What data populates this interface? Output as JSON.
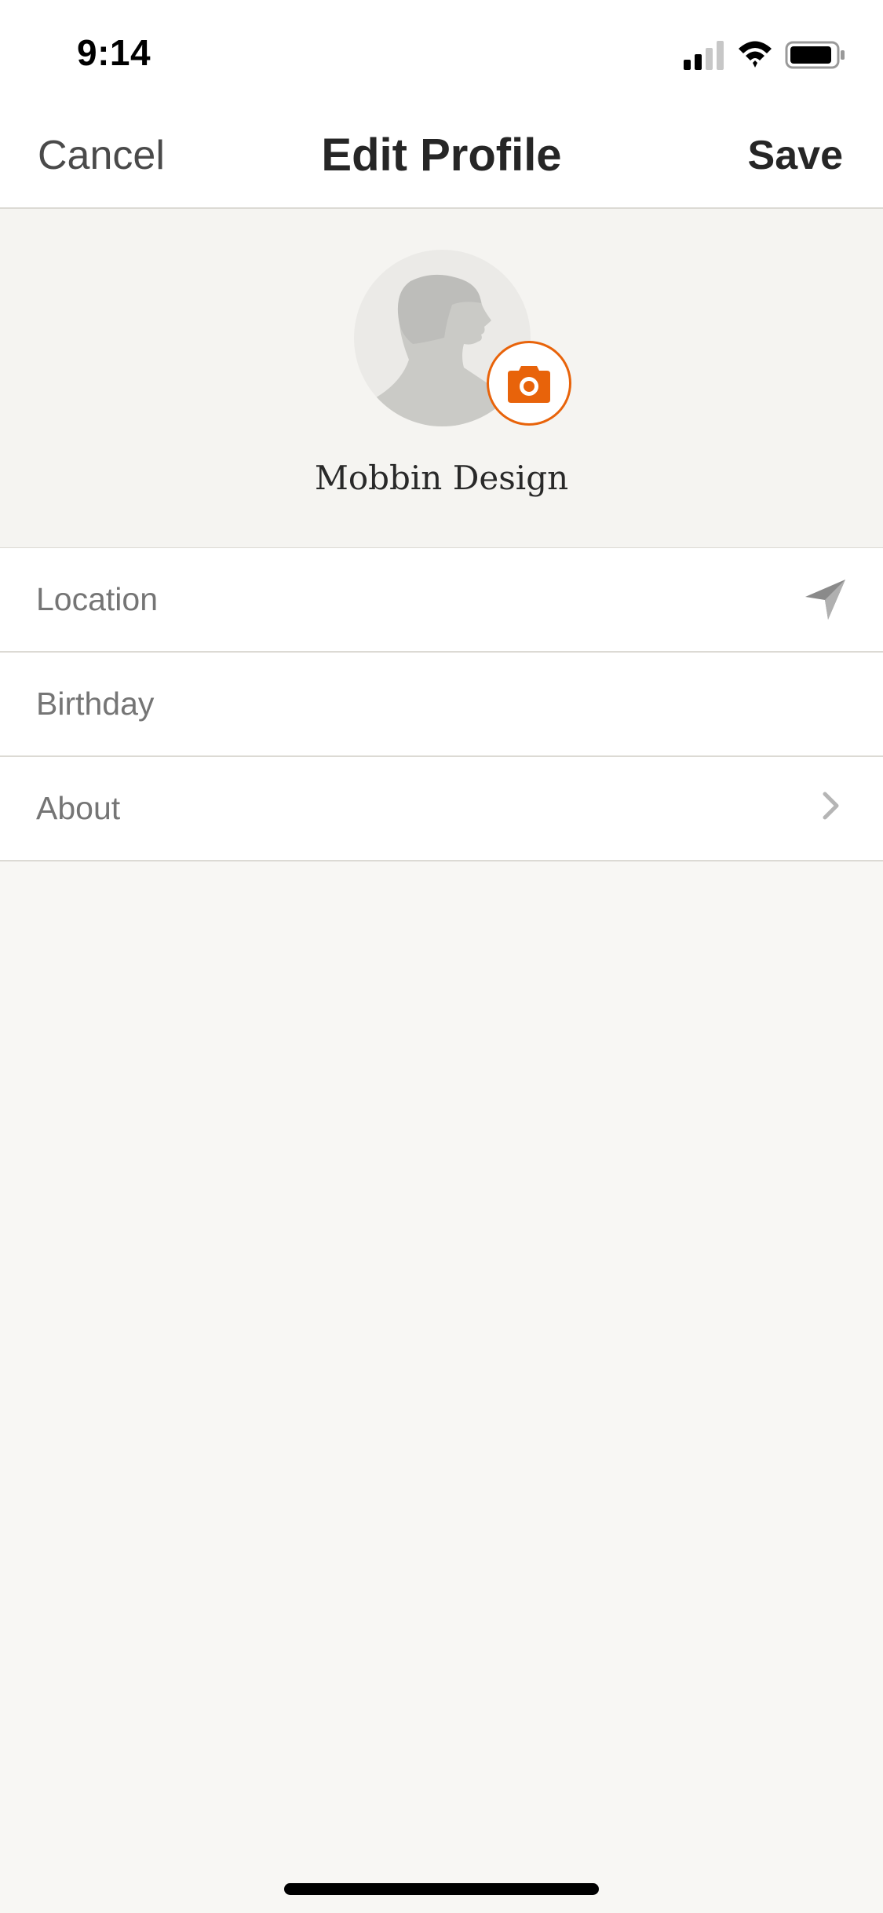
{
  "status_bar": {
    "time": "9:14",
    "icons": [
      "cellular-signal-icon",
      "wifi-icon",
      "battery-icon"
    ]
  },
  "nav": {
    "cancel_label": "Cancel",
    "title": "Edit Profile",
    "save_label": "Save"
  },
  "profile": {
    "name": "Mobbin Design",
    "avatar_icon": "avatar-silhouette-icon",
    "camera_icon": "camera-icon"
  },
  "fields": [
    {
      "label": "Location",
      "icon": "location-arrow-icon"
    },
    {
      "label": "Birthday"
    },
    {
      "label": "About",
      "icon": "chevron-right-icon"
    }
  ],
  "colors": {
    "accent": "#e8630a",
    "background": "#f8f7f4",
    "text_primary": "#262626",
    "text_secondary": "#757575"
  }
}
